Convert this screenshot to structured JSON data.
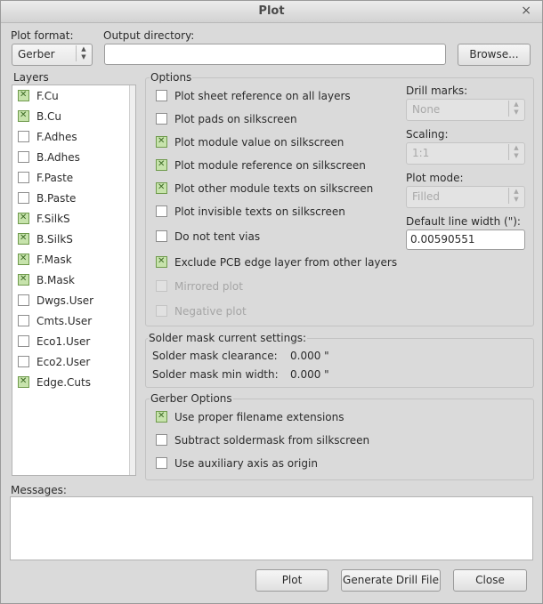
{
  "window": {
    "title": "Plot",
    "close_glyph": "×"
  },
  "plot_format": {
    "label": "Plot format:",
    "value": "Gerber"
  },
  "output_directory": {
    "label": "Output directory:",
    "value": "",
    "browse_label": "Browse..."
  },
  "layers": {
    "title": "Layers",
    "items": [
      {
        "label": "F.Cu",
        "checked": true
      },
      {
        "label": "B.Cu",
        "checked": true
      },
      {
        "label": "F.Adhes",
        "checked": false
      },
      {
        "label": "B.Adhes",
        "checked": false
      },
      {
        "label": "F.Paste",
        "checked": false
      },
      {
        "label": "B.Paste",
        "checked": false
      },
      {
        "label": "F.SilkS",
        "checked": true
      },
      {
        "label": "B.SilkS",
        "checked": true
      },
      {
        "label": "F.Mask",
        "checked": true
      },
      {
        "label": "B.Mask",
        "checked": true
      },
      {
        "label": "Dwgs.User",
        "checked": false
      },
      {
        "label": "Cmts.User",
        "checked": false
      },
      {
        "label": "Eco1.User",
        "checked": false
      },
      {
        "label": "Eco2.User",
        "checked": false
      },
      {
        "label": "Edge.Cuts",
        "checked": true
      }
    ]
  },
  "options": {
    "title": "Options",
    "items": [
      {
        "label": "Plot sheet reference on all layers",
        "checked": false,
        "enabled": true
      },
      {
        "label": "Plot pads on silkscreen",
        "checked": false,
        "enabled": true
      },
      {
        "label": "Plot module value on silkscreen",
        "checked": true,
        "enabled": true
      },
      {
        "label": "Plot module reference on silkscreen",
        "checked": true,
        "enabled": true
      },
      {
        "label": "Plot other module texts on silkscreen",
        "checked": true,
        "enabled": true
      },
      {
        "label": "Plot invisible texts on silkscreen",
        "checked": false,
        "enabled": true
      },
      {
        "label": "Do not tent vias",
        "checked": false,
        "enabled": true
      },
      {
        "label": "Exclude PCB edge layer from other layers",
        "checked": true,
        "enabled": true
      },
      {
        "label": "Mirrored plot",
        "checked": false,
        "enabled": false
      },
      {
        "label": "Negative plot",
        "checked": false,
        "enabled": false
      }
    ],
    "drill_marks": {
      "label": "Drill marks:",
      "value": "None"
    },
    "scaling": {
      "label": "Scaling:",
      "value": "1:1"
    },
    "plot_mode": {
      "label": "Plot mode:",
      "value": "Filled"
    },
    "default_line_width": {
      "label": "Default line width (\"):",
      "value": "0.00590551"
    }
  },
  "solder_mask": {
    "title": "Solder mask current settings:",
    "clearance_label": "Solder mask clearance:",
    "clearance_value": "0.000 \"",
    "min_width_label": "Solder mask min width:",
    "min_width_value": "0.000 \""
  },
  "gerber_options": {
    "title": "Gerber Options",
    "items": [
      {
        "label": "Use proper filename extensions",
        "checked": true
      },
      {
        "label": "Subtract soldermask from silkscreen",
        "checked": false
      },
      {
        "label": "Use auxiliary axis as origin",
        "checked": false
      }
    ]
  },
  "messages": {
    "label": "Messages:"
  },
  "buttons": {
    "plot": "Plot",
    "generate_drill": "Generate Drill File",
    "close": "Close"
  }
}
